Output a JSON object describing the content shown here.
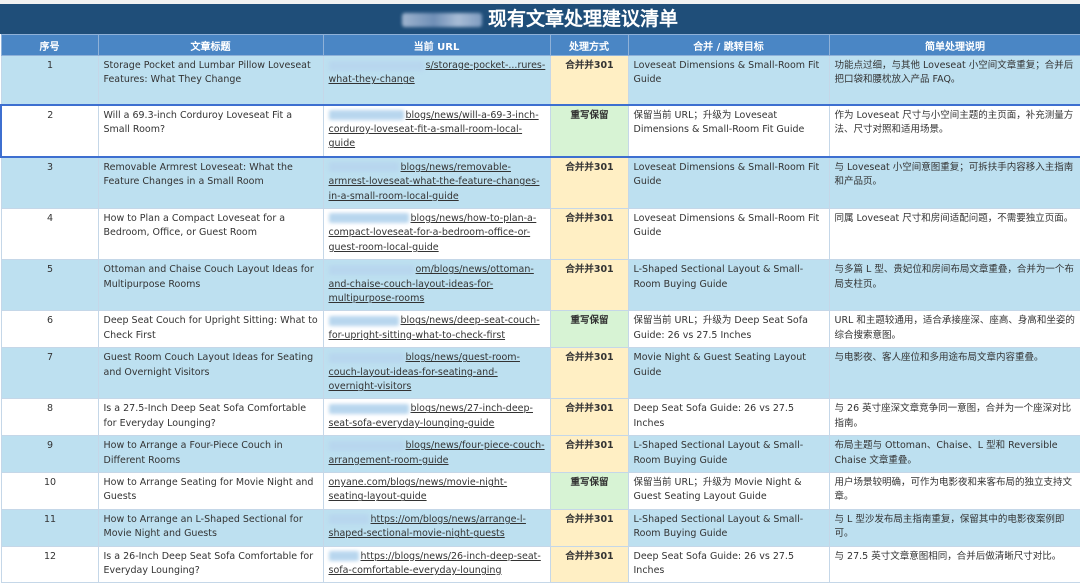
{
  "title": "现有文章处理建议清单",
  "columns": [
    "序号",
    "文章标题",
    "当前 URL",
    "处理方式",
    "合并 / 跳转目标",
    "简单处理说明"
  ],
  "rows": [
    {
      "no": "1",
      "title": "Storage Pocket and Lumbar Pillow Loveseat Features: What They Change",
      "url": "s/storage-pocket-...rures-what-they-change",
      "action": "合并并301",
      "target": "Loveseat Dimensions & Small-Room Fit Guide",
      "note": "功能点过细，与其他 Loveseat 小空间文章重复；合并后把口袋和腰枕放入产品 FAQ。"
    },
    {
      "no": "2",
      "title": "Will a 69.3-inch Corduroy Loveseat Fit a Small Room?",
      "url": "blogs/news/will-a-69-3-inch-corduroy-loveseat-fit-a-small-room-local-guide",
      "action": "重写保留",
      "target": "保留当前 URL；升级为 Loveseat Dimensions & Small-Room Fit Guide",
      "note": "作为 Loveseat 尺寸与小空间主题的主页面，补充测量方法、尺寸对照和适用场景。"
    },
    {
      "no": "3",
      "title": "Removable Armrest Loveseat: What the Feature Changes in a Small Room",
      "url": "blogs/news/removable-armrest-loveseat-what-the-feature-changes-in-a-small-room-local-guide",
      "action": "合并并301",
      "target": "Loveseat Dimensions & Small-Room Fit Guide",
      "note": "与 Loveseat 小空间意图重复；可拆扶手内容移入主指南和产品页。"
    },
    {
      "no": "4",
      "title": "How to Plan a Compact Loveseat for a Bedroom, Office, or Guest Room",
      "url": "blogs/news/how-to-plan-a-compact-loveseat-for-a-bedroom-office-or-guest-room-local-guide",
      "action": "合并并301",
      "target": "Loveseat Dimensions & Small-Room Fit Guide",
      "note": "同属 Loveseat 尺寸和房间适配问题，不需要独立页面。"
    },
    {
      "no": "5",
      "title": "Ottoman and Chaise Couch Layout Ideas for Multipurpose Rooms",
      "url": "om/blogs/news/ottoman-and-chaise-couch-layout-ideas-for-multipurpose-rooms",
      "action": "合并并301",
      "target": "L-Shaped Sectional Layout & Small-Room Buying Guide",
      "note": "与多篇 L 型、贵妃位和房间布局文章重叠，合并为一个布局支柱页。"
    },
    {
      "no": "6",
      "title": "Deep Seat Couch for Upright Sitting: What to Check First",
      "url": "blogs/news/deep-seat-couch-for-upright-sitting-what-to-check-first",
      "action": "重写保留",
      "target": "保留当前 URL；升级为 Deep Seat Sofa Guide: 26 vs 27.5 Inches",
      "note": "URL 和主题较通用，适合承接座深、座高、身高和坐姿的综合搜索意图。"
    },
    {
      "no": "7",
      "title": "Guest Room Couch Layout Ideas for Seating and Overnight Visitors",
      "url": "blogs/news/guest-room-couch-layout-ideas-for-seating-and-overnight-visitors",
      "action": "合并并301",
      "target": "Movie Night & Guest Seating Layout Guide",
      "note": "与电影夜、客人座位和多用途布局文章内容重叠。"
    },
    {
      "no": "8",
      "title": "Is a 27.5-Inch Deep Seat Sofa Comfortable for Everyday Lounging?",
      "url": "blogs/news/27-inch-deep-seat-sofa-everyday-lounging-guide",
      "action": "合并并301",
      "target": "Deep Seat Sofa Guide: 26 vs 27.5 Inches",
      "note": "与 26 英寸座深文章竞争同一意图，合并为一个座深对比指南。"
    },
    {
      "no": "9",
      "title": "How to Arrange a Four-Piece Couch in Different Rooms",
      "url": "blogs/news/four-piece-couch-arrangement-room-guide",
      "action": "合并并301",
      "target": "L-Shaped Sectional Layout & Small-Room Buying Guide",
      "note": "布局主题与 Ottoman、Chaise、L 型和 Reversible Chaise 文章重叠。"
    },
    {
      "no": "10",
      "title": "How to Arrange Seating for Movie Night and Guests",
      "url": "onyane.com/blogs/news/movie-night-seating-layout-guide",
      "action": "重写保留",
      "target": "保留当前 URL；升级为 Movie Night & Guest Seating Layout Guide",
      "note": "用户场景较明确，可作为电影夜和来客布局的独立支持文章。"
    },
    {
      "no": "11",
      "title": "How to Arrange an L-Shaped Sectional for Movie Night and Guests",
      "url": "https://om/blogs/news/arrange-l-shaped-sectional-movie-night-guests",
      "action": "合并并301",
      "target": "L-Shaped Sectional Layout & Small-Room Buying Guide",
      "note": "与 L 型沙发布局主指南重复，保留其中的电影夜案例即可。"
    },
    {
      "no": "12",
      "title": "Is a 26-Inch Deep Seat Sofa Comfortable for Everyday Lounging?",
      "url": "https://blogs/news/26-inch-deep-seat-sofa-comfortable-everyday-lounging",
      "action": "合并并301",
      "target": "Deep Seat Sofa Guide: 26 vs 27.5 Inches",
      "note": "与 27.5 英寸文章意图相同，合并后做清晰尺寸对比。"
    }
  ],
  "colors": {
    "title_bg": "#1f4e79",
    "header_bg": "#4a86c5",
    "merge_bg": "#ffefc4",
    "rewrite_bg": "#d7f3d4",
    "row_alt_bg": "#bde0f0"
  }
}
